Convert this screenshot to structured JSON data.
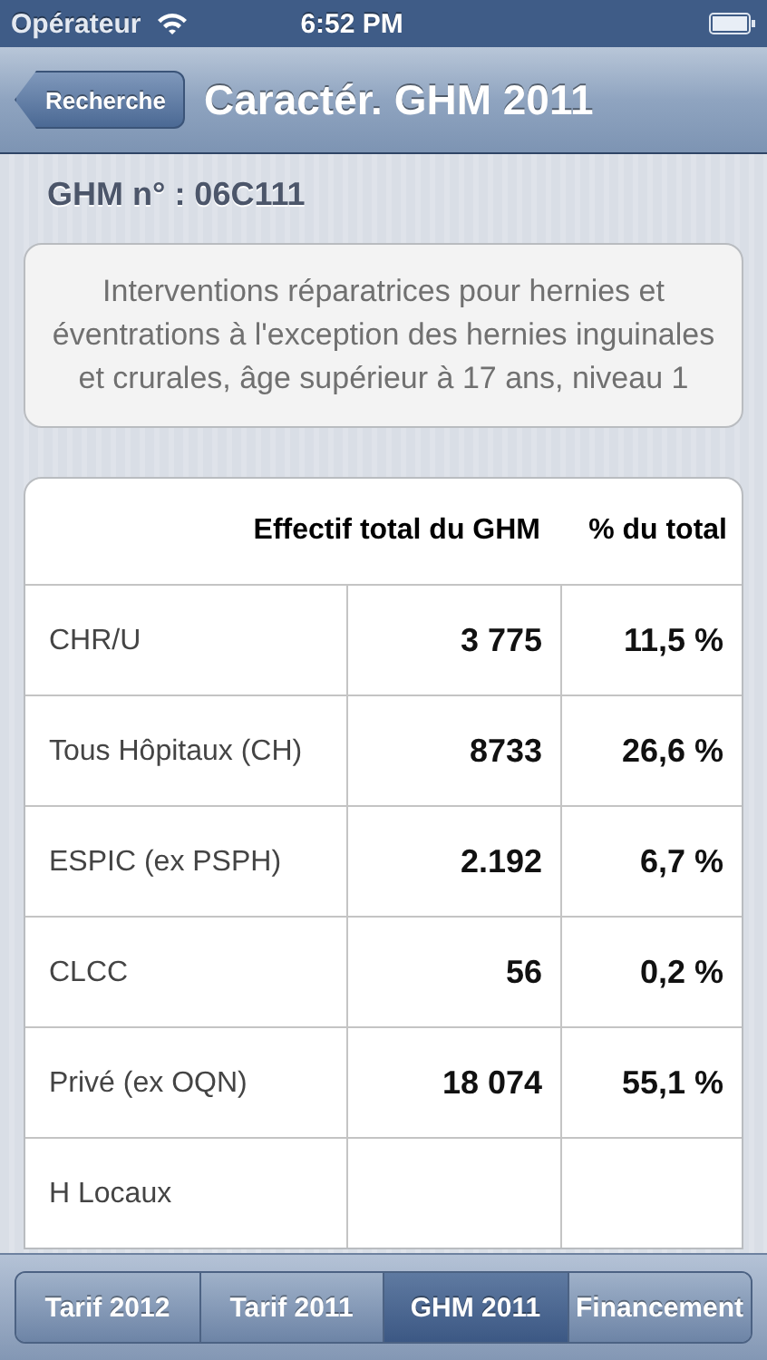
{
  "status_bar": {
    "carrier": "Opérateur",
    "time": "6:52 PM"
  },
  "nav_bar": {
    "back": "Recherche",
    "title": "Caractér. GHM 2011"
  },
  "ghm_label": "GHM n° : 06C111",
  "description": "Interventions réparatrices pour hernies et éventrations à l'exception des hernies inguinales et crurales, âge supérieur à 17 ans, niveau 1",
  "table": {
    "columns": [
      "Effectif total du GHM",
      "% du total"
    ],
    "rows": [
      {
        "label": "CHR/U",
        "count": "3 775",
        "percent": "11,5 %"
      },
      {
        "label": "Tous Hôpitaux (CH)",
        "count": "8733",
        "percent": "26,6 %"
      },
      {
        "label": "ESPIC (ex PSPH)",
        "count": "2.192",
        "percent": "6,7 %"
      },
      {
        "label": "CLCC",
        "count": "56",
        "percent": "0,2 %"
      },
      {
        "label": "Privé (ex OQN)",
        "count": "18 074",
        "percent": "55,1 %"
      },
      {
        "label": "H Locaux"
      }
    ]
  },
  "tabs": [
    {
      "label": "Tarif 2012",
      "selected": false
    },
    {
      "label": "Tarif 2011",
      "selected": false
    },
    {
      "label": "GHM 2011",
      "selected": true
    },
    {
      "label": "Financement",
      "selected": false
    }
  ]
}
